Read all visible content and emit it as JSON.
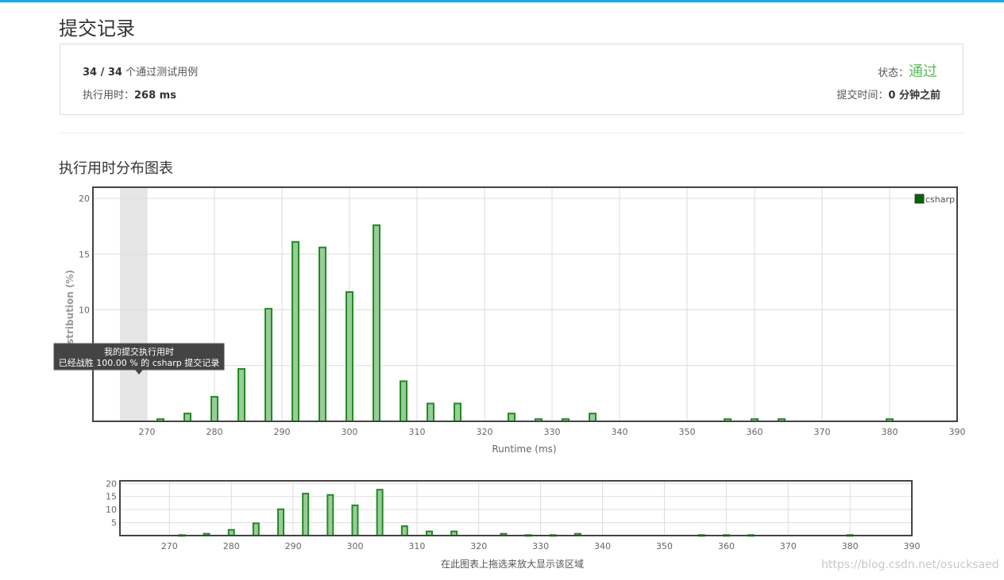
{
  "page_title": "提交记录",
  "summary": {
    "tests_passed": "34 / 34",
    "tests_label": "个通过测试用例",
    "runtime_label": "执行用时：",
    "runtime_value": "268 ms",
    "status_label": "状态：",
    "status_value": "通过",
    "submit_time_label": "提交时间：",
    "submit_time_value": "0 分钟之前"
  },
  "section_title": "执行用时分布图表",
  "colors": {
    "bar_fill": "#99cc99",
    "bar_stroke": "#228b22",
    "legend": "#006600",
    "status": "#5cb85c",
    "accent_bar": "#1aa6e8"
  },
  "chart_data": [
    {
      "type": "bar",
      "xlabel": "Runtime (ms)",
      "ylabel": "Distribution (%)",
      "xlim": [
        262,
        390
      ],
      "ylim": [
        0,
        21
      ],
      "x_ticks": [
        270,
        280,
        290,
        300,
        310,
        320,
        330,
        340,
        350,
        360,
        370,
        380,
        390
      ],
      "y_ticks": [
        5,
        10,
        15,
        20
      ],
      "grid": true,
      "legend_position": "top-right",
      "series": [
        {
          "name": "csharp",
          "x": [
            272,
            276,
            280,
            284,
            288,
            292,
            296,
            300,
            304,
            308,
            312,
            316,
            324,
            328,
            332,
            336,
            356,
            360,
            364,
            380
          ],
          "values": [
            0.2,
            0.7,
            2.2,
            4.7,
            10.1,
            16.1,
            15.6,
            11.6,
            17.6,
            3.6,
            1.6,
            1.6,
            0.7,
            0.2,
            0.2,
            0.7,
            0.2,
            0.2,
            0.2,
            0.2
          ]
        }
      ],
      "highlight_band": [
        266,
        270
      ],
      "tooltip": {
        "line1": "我的提交执行用时",
        "line2": "已经战胜 100.00 % 的 csharp 提交记录"
      }
    },
    {
      "type": "bar",
      "xlim": [
        262,
        390
      ],
      "ylim": [
        0,
        21
      ],
      "x_ticks": [
        270,
        280,
        290,
        300,
        310,
        320,
        330,
        340,
        350,
        360,
        370,
        380,
        390
      ],
      "y_ticks": [
        5,
        10,
        15,
        20
      ],
      "grid": true,
      "caption": "在此图表上拖选来放大显示该区域",
      "series": [
        {
          "x": [
            272,
            276,
            280,
            284,
            288,
            292,
            296,
            300,
            304,
            308,
            312,
            316,
            324,
            328,
            332,
            336,
            356,
            360,
            364,
            380
          ],
          "values": [
            0.2,
            0.7,
            2.2,
            4.7,
            10.1,
            16.1,
            15.6,
            11.6,
            17.6,
            3.6,
            1.6,
            1.6,
            0.7,
            0.2,
            0.2,
            0.7,
            0.2,
            0.2,
            0.2,
            0.2
          ]
        }
      ]
    }
  ],
  "watermark": "https://blog.csdn.net/osucksaed"
}
